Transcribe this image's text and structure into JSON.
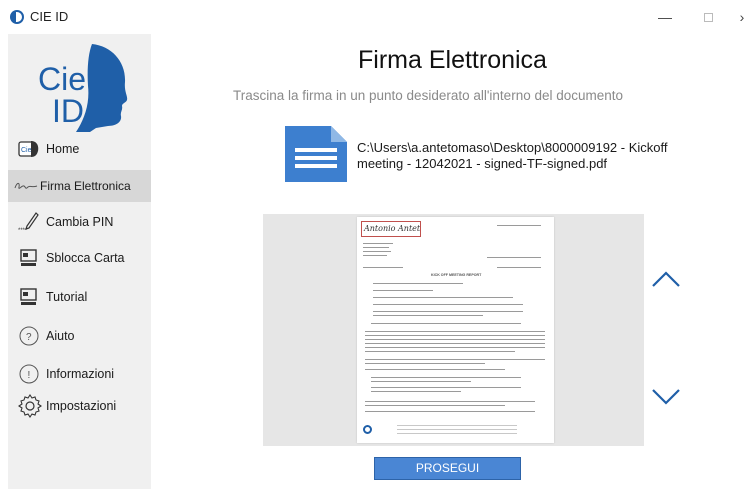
{
  "window": {
    "title": "CIE ID",
    "controls": {
      "minimize": "—",
      "maximize": "",
      "close": "›"
    }
  },
  "logo": {
    "line1": "Cie",
    "line2": "ID"
  },
  "sidebar": {
    "items": [
      {
        "label": "Home",
        "icon": "cie-card-icon",
        "active": false
      },
      {
        "label": "Firma Elettronica",
        "icon": "signature-icon",
        "active": true
      },
      {
        "label": "Cambia PIN",
        "icon": "pencil-pin-icon",
        "active": false
      },
      {
        "label": "Sblocca Carta",
        "icon": "card-unlock-icon",
        "active": false
      },
      {
        "label": "Tutorial",
        "icon": "tutorial-icon",
        "active": false
      },
      {
        "label": "Aiuto",
        "icon": "question-icon",
        "active": false
      },
      {
        "label": "Informazioni",
        "icon": "info-icon",
        "active": false
      },
      {
        "label": "Impostazioni",
        "icon": "gear-icon",
        "active": false
      }
    ]
  },
  "main": {
    "title": "Firma Elettronica",
    "subtitle": "Trascina la firma in un punto desiderato all'interno del documento",
    "file_path_line1": "C:\\Users\\a.antetomaso\\Desktop\\8000009192 - Kickoff",
    "file_path_line2": "meeting - 12042021 - signed-TF-signed.pdf",
    "signature_text": "Antonio Antetomaso",
    "doc_heading": "KICK OFF MEETING REPORT",
    "proceed_label": "PROSEGUI"
  },
  "colors": {
    "accent_button": "#4a86d4",
    "logo_blue": "#1f5fa8",
    "arrow_blue": "#1f5fa8",
    "sidebar_bg": "#f0f0f0",
    "active_bg": "#d7d7d7"
  }
}
